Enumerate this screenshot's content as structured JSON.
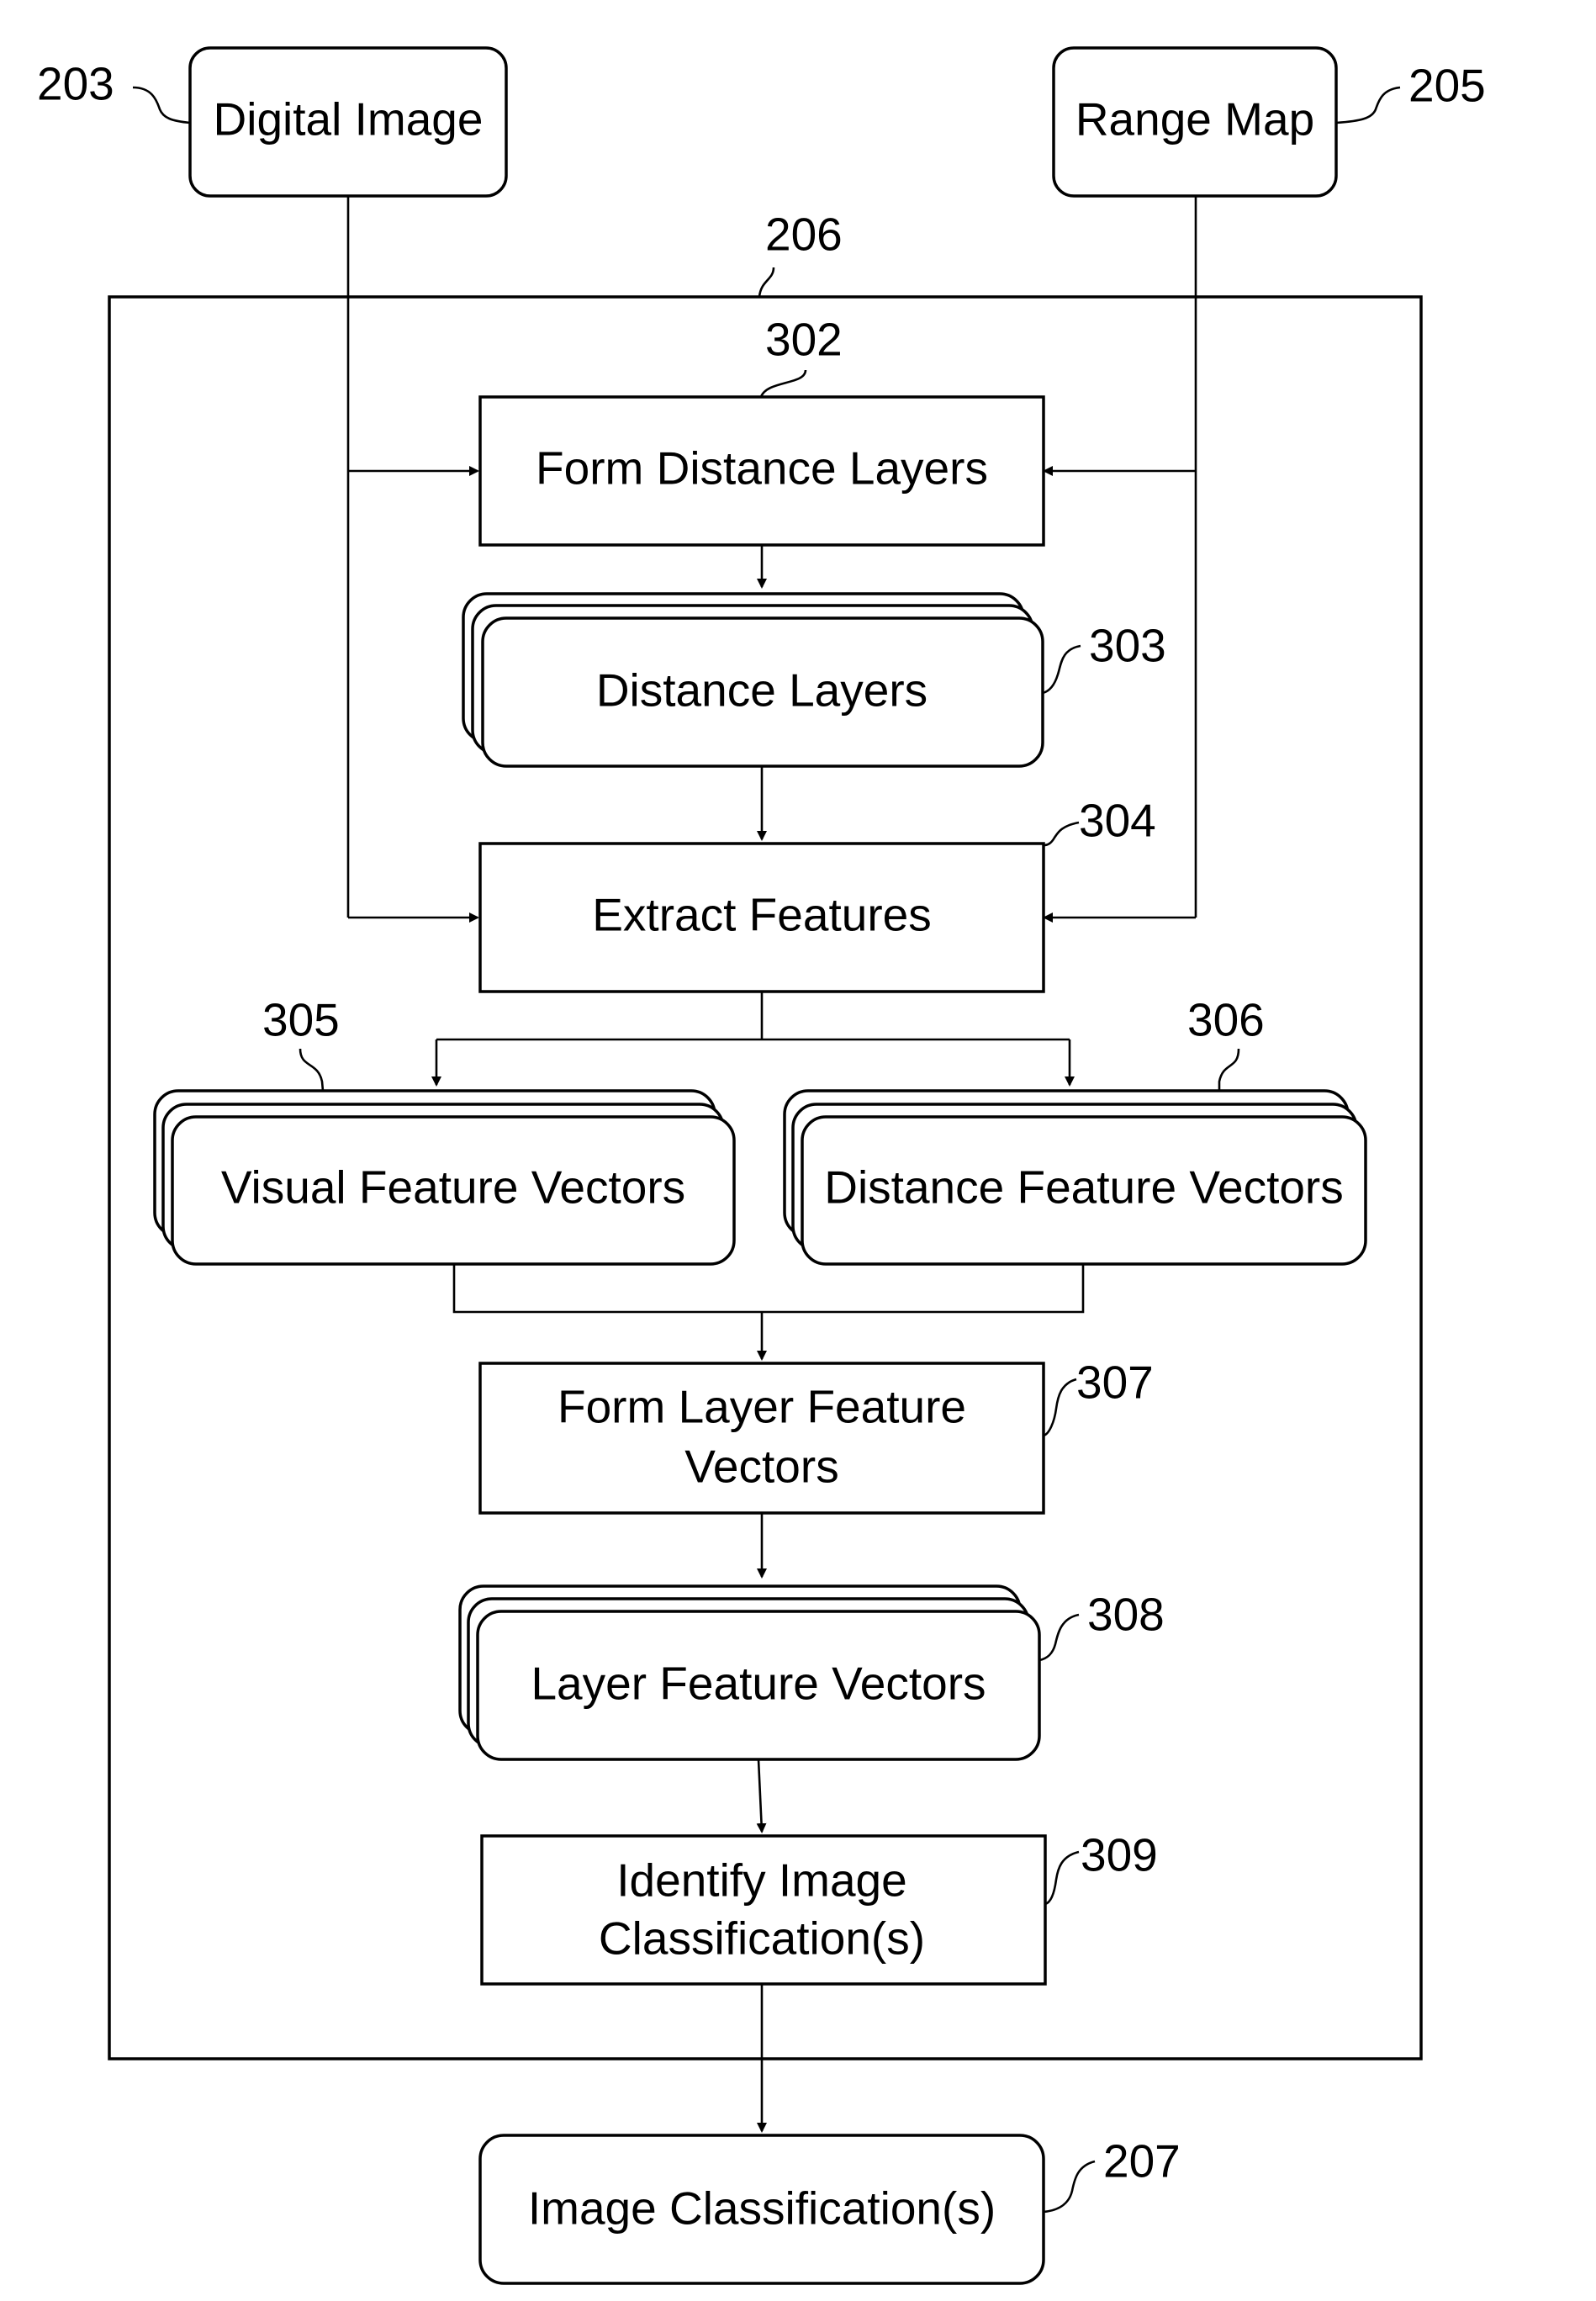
{
  "diagram": {
    "type": "flowchart",
    "nodes": {
      "digital_image": {
        "label": "Digital Image",
        "ref": "203",
        "shape": "rounded"
      },
      "range_map": {
        "label": "Range Map",
        "ref": "205",
        "shape": "rounded"
      },
      "container": {
        "ref": "206"
      },
      "form_distance_layers": {
        "label": "Form Distance Layers",
        "ref": "302",
        "shape": "rect"
      },
      "distance_layers": {
        "label": "Distance Layers",
        "ref": "303",
        "shape": "stacked-rounded"
      },
      "extract_features": {
        "label": "Extract Features",
        "ref": "304",
        "shape": "rect"
      },
      "visual_feature_vectors": {
        "label": "Visual Feature Vectors",
        "ref": "305",
        "shape": "stacked-rounded"
      },
      "distance_feature_vectors": {
        "label": "Distance Feature Vectors",
        "ref": "306",
        "shape": "stacked-rounded"
      },
      "form_layer_feature_vectors": {
        "label_line1": "Form Layer Feature",
        "label_line2": "Vectors",
        "ref": "307",
        "shape": "rect"
      },
      "layer_feature_vectors": {
        "label": "Layer Feature Vectors",
        "ref": "308",
        "shape": "stacked-rounded"
      },
      "identify_image_classification": {
        "label_line1": "Identify Image",
        "label_line2": "Classification(s)",
        "ref": "309",
        "shape": "rect"
      },
      "image_classifications": {
        "label": "Image Classification(s)",
        "ref": "207",
        "shape": "rounded"
      }
    },
    "edges": [
      [
        "digital_image",
        "form_distance_layers"
      ],
      [
        "range_map",
        "form_distance_layers"
      ],
      [
        "form_distance_layers",
        "distance_layers"
      ],
      [
        "distance_layers",
        "extract_features"
      ],
      [
        "digital_image",
        "extract_features"
      ],
      [
        "range_map",
        "extract_features"
      ],
      [
        "extract_features",
        "visual_feature_vectors"
      ],
      [
        "extract_features",
        "distance_feature_vectors"
      ],
      [
        "visual_feature_vectors",
        "form_layer_feature_vectors"
      ],
      [
        "distance_feature_vectors",
        "form_layer_feature_vectors"
      ],
      [
        "form_layer_feature_vectors",
        "layer_feature_vectors"
      ],
      [
        "layer_feature_vectors",
        "identify_image_classification"
      ],
      [
        "identify_image_classification",
        "image_classifications"
      ]
    ]
  }
}
